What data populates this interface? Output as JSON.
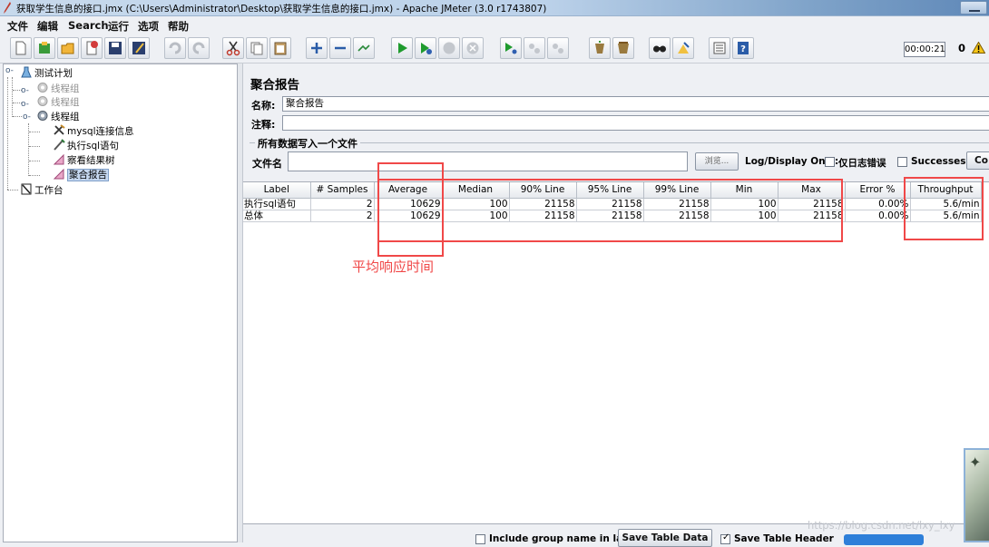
{
  "window": {
    "title": "获取学生信息的接口.jmx (C:\\Users\\Administrator\\Desktop\\获取学生信息的接口.jmx) - Apache JMeter (3.0 r1743807)"
  },
  "menu": [
    "文件",
    "编辑",
    "Search",
    "运行",
    "选项",
    "帮助"
  ],
  "toolbar": {
    "icons": [
      "new-icon",
      "templates-icon",
      "open-icon",
      "close-icon",
      "save-icon",
      "save-as-icon",
      "undo-icon",
      "redo-icon",
      "cut-icon",
      "copy-icon",
      "paste-icon",
      "expand-icon",
      "collapse-icon",
      "toggle-icon",
      "start-icon",
      "start-no-pause-icon",
      "stop-icon",
      "shutdown-icon",
      "remote-start-icon",
      "remote-stop-icon",
      "remote-exit-icon",
      "clear-icon",
      "clear-all-icon",
      "search-icon",
      "reset-search-icon",
      "function-helper-icon",
      "help-icon"
    ],
    "timer": "00:00:21",
    "error_count": "0"
  },
  "tree": [
    {
      "label": "测试计划",
      "icon": "test-plan-icon",
      "disabled": false,
      "selected": false
    },
    {
      "label": "线程组",
      "icon": "thread-group-icon",
      "disabled": true,
      "selected": false
    },
    {
      "label": "线程组",
      "icon": "thread-group-icon",
      "disabled": true,
      "selected": false
    },
    {
      "label": "线程组",
      "icon": "thread-group-icon",
      "disabled": false,
      "selected": false
    },
    {
      "label": "mysql连接信息",
      "icon": "config-element-icon",
      "disabled": false,
      "selected": false
    },
    {
      "label": "执行sql语句",
      "icon": "sampler-icon",
      "disabled": false,
      "selected": false
    },
    {
      "label": "察看结果树",
      "icon": "listener-icon",
      "disabled": false,
      "selected": false
    },
    {
      "label": "聚合报告",
      "icon": "listener-icon",
      "disabled": false,
      "selected": true
    },
    {
      "label": "工作台",
      "icon": "workbench-icon",
      "disabled": false,
      "selected": false
    }
  ],
  "panel": {
    "title": "聚合报告",
    "name_label": "名称:",
    "name_value": "聚合报告",
    "comment_label": "注释:",
    "comment_value": "",
    "group_label": "所有数据写入一个文件",
    "file_label": "文件名",
    "file_value": "",
    "browse_button": "浏览...",
    "log_display_label": "Log/Display Only:",
    "errors_label": "仅日志错误",
    "successes_label": "Successes",
    "configure_button": "Co"
  },
  "table": {
    "headers": [
      "Label",
      "# Samples",
      "Average",
      "Median",
      "90% Line",
      "95% Line",
      "99% Line",
      "Min",
      "Max",
      "Error %",
      "Throughput"
    ],
    "rows": [
      [
        "执行sql语句",
        "2",
        "10629",
        "100",
        "21158",
        "21158",
        "21158",
        "100",
        "21158",
        "0.00%",
        "5.6/min"
      ],
      [
        "总体",
        "2",
        "10629",
        "100",
        "21158",
        "21158",
        "21158",
        "100",
        "21158",
        "0.00%",
        "5.6/min"
      ]
    ]
  },
  "annotation": {
    "text": "平均响应时间",
    "color": "#f04848"
  },
  "bottom": {
    "include_group_label": "Include group name in label?",
    "include_group_checked": false,
    "save_table_data_button": "Save Table Data",
    "save_table_header_label": "Save Table Header",
    "save_table_header_checked": true
  },
  "watermark": "https://blog.csdn.net/lxy_lxy",
  "colors": {
    "highlight_red": "#f04848",
    "selection_blue": "#c6d8f0"
  }
}
